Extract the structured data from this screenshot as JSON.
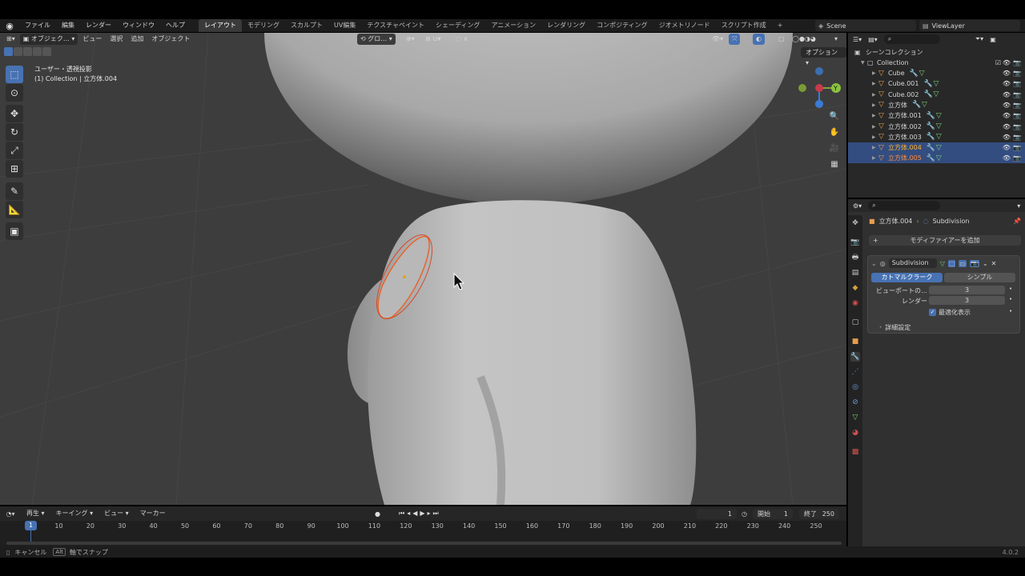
{
  "topbar": {
    "menus": [
      "ファイル",
      "編集",
      "レンダー",
      "ウィンドウ",
      "ヘルプ"
    ],
    "workspaces": [
      "レイアウト",
      "モデリング",
      "スカルプト",
      "UV編集",
      "テクスチャペイント",
      "シェーディング",
      "アニメーション",
      "レンダリング",
      "コンポジティング",
      "ジオメトリノード",
      "スクリプト作成"
    ],
    "active_workspace": "レイアウト",
    "add_tab": "+",
    "scene": "Scene",
    "view_layer": "ViewLayer"
  },
  "viewport": {
    "mode": "オブジェク…",
    "menus": [
      "ビュー",
      "選択",
      "追加",
      "オブジェクト"
    ],
    "transform_orientation": "グロ…",
    "view_name": "ユーザー・透視投影",
    "context": "(1) Collection | 立方体.004",
    "options": "オプション",
    "gizmo_axes": [
      "X",
      "Y",
      "Z"
    ]
  },
  "outliner": {
    "root": "シーンコレクション",
    "collection": "Collection",
    "items": [
      {
        "name": "Cube",
        "selected": false,
        "active": false
      },
      {
        "name": "Cube.001",
        "selected": false,
        "active": false
      },
      {
        "name": "Cube.002",
        "selected": false,
        "active": false
      },
      {
        "name": "立方体",
        "selected": false,
        "active": false
      },
      {
        "name": "立方体.001",
        "selected": false,
        "active": false
      },
      {
        "name": "立方体.002",
        "selected": false,
        "active": false
      },
      {
        "name": "立方体.003",
        "selected": false,
        "active": false
      },
      {
        "name": "立方体.004",
        "selected": true,
        "active": true
      },
      {
        "name": "立方体.005",
        "selected": true,
        "active": false
      }
    ]
  },
  "properties": {
    "object": "立方体.004",
    "modifier_context": "Subdivision",
    "add_modifier": "モディファイアーを追加",
    "modifier": {
      "name": "Subdivision",
      "type_options": [
        "カトマルクラーク",
        "シンプル"
      ],
      "selected_type": "カトマルクラーク",
      "viewport_label": "ビューポートの…",
      "viewport_value": "3",
      "render_label": "レンダー",
      "render_value": "3",
      "optimal_display": "最適化表示",
      "advanced": "詳細設定"
    }
  },
  "timeline": {
    "menus": [
      "再生",
      "キーイング",
      "ビュー",
      "マーカー"
    ],
    "current_frame": "1",
    "start_label": "開始",
    "start": "1",
    "end_label": "終了",
    "end": "250",
    "ruler": [
      "10",
      "20",
      "30",
      "40",
      "50",
      "60",
      "70",
      "80",
      "90",
      "100",
      "110",
      "120",
      "130",
      "140",
      "150",
      "160",
      "170",
      "180",
      "190",
      "200",
      "210",
      "220",
      "230",
      "240",
      "250"
    ],
    "playhead": "1"
  },
  "statusbar": {
    "cancel": "キャンセル",
    "alt_key": "Alt",
    "snap": "軸でスナップ",
    "version": "4.0.2"
  },
  "colors": {
    "accent": "#4772b3",
    "selection_outline": "#e8642c",
    "viewport_bg": "#3d3d3d"
  }
}
